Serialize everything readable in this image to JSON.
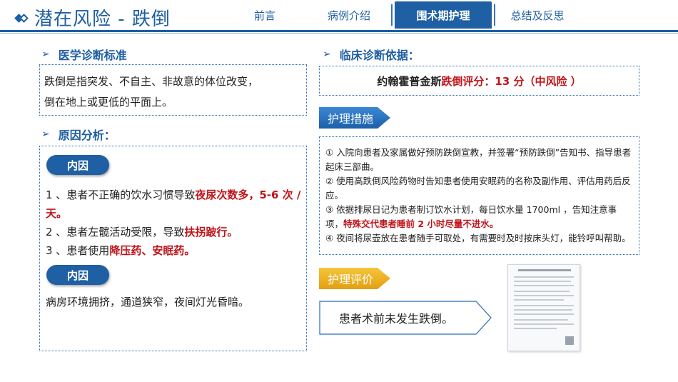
{
  "header": {
    "title": "潜在风险 - 跌倒",
    "nav": [
      "前言",
      "病例介绍",
      "围术期护理",
      "总结及反思"
    ],
    "active_nav_index": 2
  },
  "left": {
    "diagnosis_heading": "医学诊断标准",
    "diagnosis_text_line1": "跌倒是指突发、不自主、非故意的体位改变，",
    "diagnosis_text_line2": "倒在地上或更低的平面上。",
    "cause_heading": "原因分析：",
    "pill1": "内因",
    "cause1_a": "1 、患者不正确的饮水习惯导致",
    "cause1_red": "夜尿次数多，5-6 次 / 天。",
    "cause2_a": "2 、患者左髋活动受限，导致",
    "cause2_red": "扶拐跛行。",
    "cause3_a": "3 、患者使用",
    "cause3_red": "降压药、安眠药。",
    "pill2": "内因",
    "env_text": "病房环境拥挤，通道狭窄，夜间灯光昏暗。"
  },
  "right": {
    "basis_heading": "临床诊断依据：",
    "score_a": "约翰霍普金斯",
    "score_red": "跌倒评分：",
    "score_b": " 13 分（中风险 ）",
    "measures_banner": "护理措施",
    "m1": "① 入院向患者及家属做好预防跌倒宣教，并签署“预防跌倒”告知书、指导患者起床三部曲。",
    "m2": "② 使用高跌倒风险药物时告知患者使用安眠药的名称及副作用、评估用药后反应。",
    "m3_a": "③ 依据排尿日记为患者制订饮水计划，每日饮水量 1700ml ，告知注意事项，",
    "m3_red": "特殊交代患者睡前 2 小时尽量不进水。",
    "m4": "④ 夜间将尿壶放在患者随手可取处，有需要时及时按床头灯，能铃呼叫帮助。",
    "eval_banner": "护理评价",
    "eval_text": "患者术前未发生跌倒。"
  },
  "colors": {
    "primary": "#1f5fa3",
    "accent_red": "#c0141a",
    "gold": "#e2a012"
  }
}
